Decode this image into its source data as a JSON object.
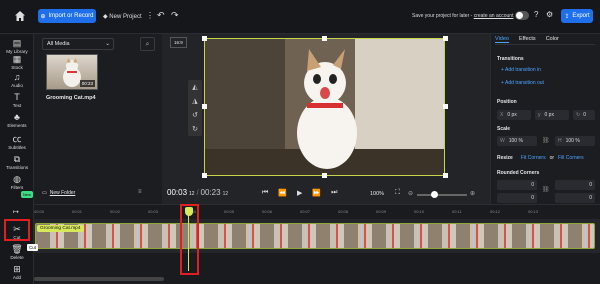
{
  "toolbar": {
    "import_label": "Import or Record",
    "new_project_label": "New Project",
    "save_note": "Save your project for later -",
    "create_account": "create an account",
    "export_label": "Export"
  },
  "sidebar": {
    "items": [
      {
        "label": "My Library",
        "icon": "library-icon"
      },
      {
        "label": "Stock",
        "icon": "stock-icon"
      },
      {
        "label": "Audio",
        "icon": "music-icon"
      },
      {
        "label": "Text",
        "icon": "text-icon"
      },
      {
        "label": "Elements",
        "icon": "elements-icon"
      },
      {
        "label": "Subtitles",
        "icon": "cc-icon"
      },
      {
        "label": "Transitions",
        "icon": "transitions-icon"
      },
      {
        "label": "Filters",
        "icon": "filters-icon"
      },
      {
        "label": "Cut",
        "icon": "scissors-icon"
      },
      {
        "label": "Delete",
        "icon": "trash-icon"
      },
      {
        "label": "Add",
        "icon": "add-icon"
      }
    ],
    "new_badge": "New"
  },
  "library": {
    "filter": "All Media",
    "clip_name": "Grooming Cat.mp4",
    "clip_duration": "00:23",
    "new_folder": "New Folder"
  },
  "preview": {
    "aspect": "16:9",
    "current_time": "00:03",
    "current_frames": "12",
    "total_time": "00:23",
    "total_frames": "12",
    "zoom": "100%"
  },
  "panel": {
    "tabs": [
      "Video",
      "Effects",
      "Color"
    ],
    "transitions_title": "Transitions",
    "add_in": "+ Add transition in",
    "add_out": "+ Add transition out",
    "position_title": "Position",
    "x_label": "X",
    "x_value": "0 px",
    "y_label": "y",
    "y_value": "0 px",
    "rot_value": "0",
    "scale_title": "Scale",
    "w_label": "W",
    "w_value": "100 %",
    "h_label": "H",
    "h_value": "100 %",
    "resize_title": "Resize",
    "fit_corners": "Fit Corners",
    "or": "or",
    "fill_corners": "Fill Corners",
    "rounded_title": "Rounded Corners",
    "corner_values": [
      "0",
      "0",
      "0",
      "0"
    ]
  },
  "timeline": {
    "ticks": [
      "00:00",
      "00:01",
      "00:02",
      "00:03",
      "00:04",
      "00:05",
      "00:06",
      "00:07",
      "00:08",
      "00:09",
      "00:10",
      "00:11",
      "00:12",
      "00:13"
    ],
    "clip_label": "Grooming Cat.mp4",
    "cut_tooltip": "Cut"
  }
}
